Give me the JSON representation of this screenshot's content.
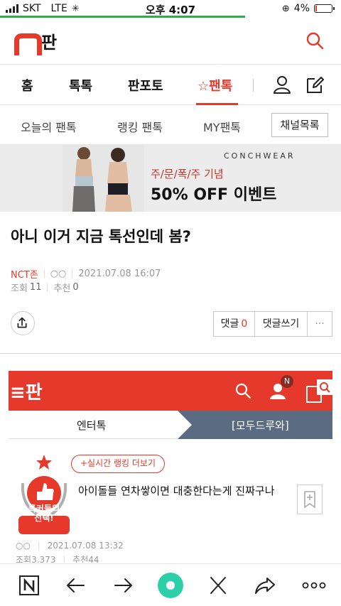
{
  "status_bar": {
    "carrier": "SKT",
    "network": "LTE",
    "time": "오후 4:07",
    "battery": "4%"
  },
  "header": {
    "logo_text": "판"
  },
  "main_nav": {
    "tabs": [
      "홈",
      "톡톡",
      "판포토",
      "☆팬톡"
    ],
    "active_index": 3
  },
  "sub_nav": {
    "items": [
      "오늘의 팬톡",
      "랭킹 팬톡",
      "MY팬톡"
    ],
    "channel_button": "채널목록"
  },
  "ad_banner": {
    "brand": "CONCHWEAR",
    "subtitle": "주/문/폭/주 기념",
    "headline": "50% OFF 이벤트"
  },
  "article": {
    "title": "아니 이거 지금 톡선인데 봄?",
    "author": "NCT존",
    "author_mask": "○○",
    "date": "2021.07.08 16:07",
    "views_label": "조회",
    "views": "11",
    "recommend_label": "추천",
    "recommend": "0"
  },
  "actions": {
    "comment_label": "댓글",
    "comment_count": "0",
    "write_comment": "댓글쓰기",
    "more": "···"
  },
  "embedded": {
    "logo": "≡판",
    "notification_badge": "N",
    "tab_left": "엔터톡",
    "tab_right": "[모두드루와]",
    "ranking_button": "+실시간 랭킹 더보기",
    "badge_text_1": "톡커들의",
    "badge_text_2": "선택!",
    "post_title": "아이돌들 연차쌓이면 대충한다는게 진짜구나",
    "meta_author": "○○",
    "meta_date": "2021.07.08 13:32",
    "views_label": "조회",
    "views": "3,373",
    "recommend_label": "추천",
    "recommend": "44"
  },
  "colors": {
    "brand_red": "#e5392c",
    "tab_slate": "#5b6b82",
    "load_green": "#34a853"
  }
}
